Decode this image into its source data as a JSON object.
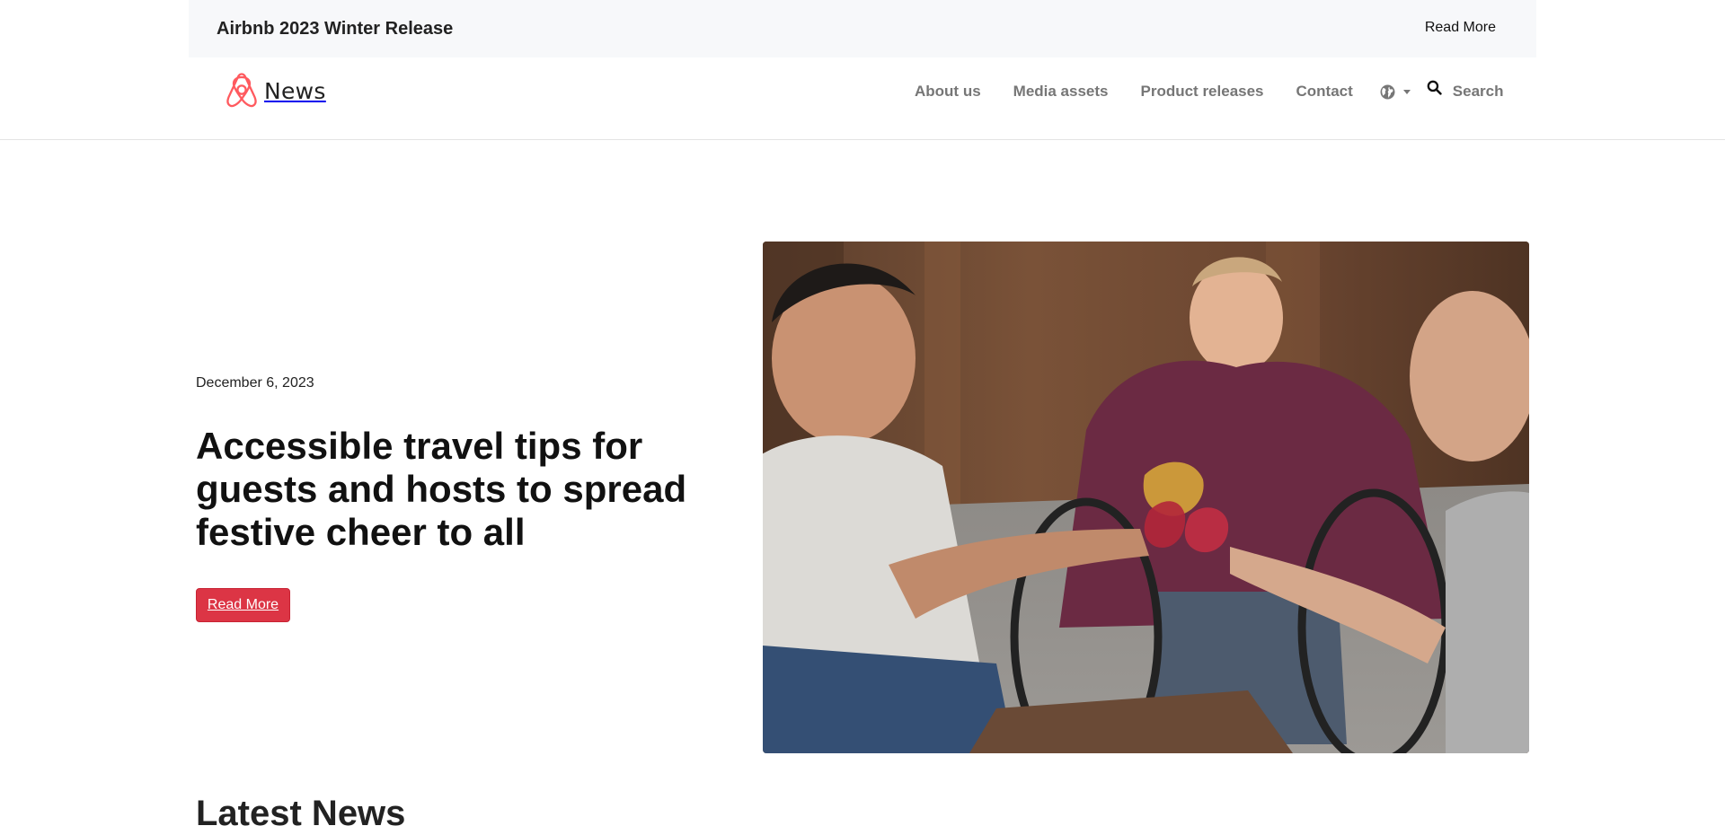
{
  "banner": {
    "title": "Airbnb 2023 Winter Release",
    "link_label": "Read More"
  },
  "brand": {
    "logo_icon": "airbnb-belo-logo",
    "name": "News",
    "accent_color": "#ff5a5f"
  },
  "nav": {
    "items": [
      {
        "label": "About us"
      },
      {
        "label": "Media assets"
      },
      {
        "label": "Product releases"
      },
      {
        "label": "Contact"
      }
    ],
    "language_icon": "globe-icon",
    "search_icon": "search-icon",
    "search_label": "Search"
  },
  "hero": {
    "date": "December 6, 2023",
    "title": "Accessible travel tips for guests and hosts to spread festive cheer to all",
    "button_label": "Read More",
    "button_color": "#dc3545",
    "image_subject": "three friends toasting with glasses, one using a wheelchair"
  },
  "latest": {
    "heading": "Latest News"
  }
}
